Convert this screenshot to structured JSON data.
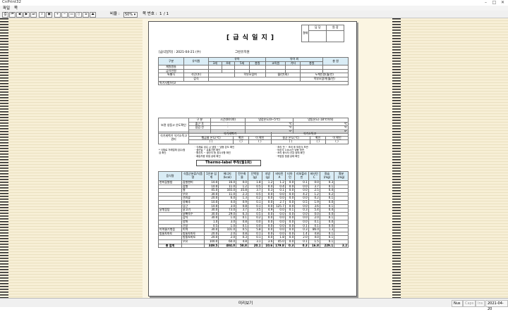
{
  "window": {
    "title": "CnPrint32"
  },
  "menu": {
    "items": [
      "파일",
      "쪽"
    ]
  },
  "toolbar": {
    "zoom_label": "비율 :",
    "zoom_value": "50%",
    "page_label": "쪽 번호 :",
    "page_value": "1",
    "page_total": "/ 1"
  },
  "doc": {
    "title": "[ 급 식 일 지 ]",
    "approval": {
      "side": "결재",
      "heads": [
        "담 당",
        "원 장"
      ]
    },
    "meal_date_label": "[급식일자] : 2021-04-21 (수)",
    "facility": "그린유치원",
    "attend": {
      "col_gubun": "구분",
      "col_teacher": "유치원",
      "col_child": "유아",
      "col_child_sub": "유아 외",
      "col_total": "총 원",
      "sub": [
        "3세",
        "4세",
        "5세",
        "총원",
        "교직원",
        "기타",
        "총원"
      ],
      "rows": [
        "재원원들",
        "급식인원"
      ]
    },
    "meal_rows": {
      "label": "특별식",
      "r1": "식단(조)",
      "r1b": "학부모참여",
      "r1c": "월/년(회)",
      "r1d": "누계인원(월/년)",
      "r2": "감식",
      "r2b": "학부모참여(월/년)"
    },
    "remarks": "특기사항/비고",
    "storage": {
      "title": "보관 냉동고 온도확인",
      "heads": [
        "구 분",
        "시간(00:00)",
        "냉장온도(0~5℃)",
        "냉동온도(-18℃이하)"
      ],
      "rows": [
        [
          "출근 후",
          ":",
          "℃",
          "℃"
        ],
        [
          "점검 전",
          ":",
          "℃",
          "℃"
        ],
        [
          "",
          ":",
          "℃",
          "℃"
        ]
      ]
    },
    "wash": {
      "title": "식기세척기 식기소독고 관리",
      "left_head": "식기세척기",
      "right_head": "식기소독고",
      "left": [
        "헹굼물 온도(℃)",
        "확인",
        "이 확인"
      ],
      "right": [
        "살균 온도(℃)",
        "확인",
        "이 확인"
      ],
      "blank": "(  )"
    },
    "notes_title": "* 식재료 거래업체 검수/점검 확인",
    "notes_left": [
      "· 식재료 검수 시 냉장 ~ 냉동 온도 확인",
      "· 생산일 ~ 유통기한 확인",
      "· 원산지 ~ 생산자 등 표시사항 확인",
      "· 배송차량 위생 상태 확인"
    ],
    "notes_right": [
      "· 조리 전 ~ 조리 후 보존식 보관",
      "· 보존식 144시간 냉동 보관",
      "· 조리 종사자 건강 상태 확인",
      "· 작업장 청결 상태 확인"
    ],
    "thermo": "Thermo-label 부착(월1회)",
    "table": {
      "heads": [
        "음식명",
        "식품군분류/식품명",
        "1인분 섭취",
        "에너지 (kcal)",
        "탄수화물",
        "단백질 (g)",
        "지방 (g)",
        "비타민A",
        "티아민",
        "리보플라빈",
        "비타민C",
        "칼슘 (mg)",
        "철분 (mg)"
      ],
      "meal_groups": [
        "현미찹쌀밥",
        "닭볶음탕",
        "미역줄기볶음",
        "방울토마토",
        "총 합계"
      ],
      "rows": [
        [
          "현미찹쌀밥",
          "찹쌀현미",
          "10.0",
          "16.0",
          "0.0",
          "1.8",
          "1.2",
          "1.2",
          "0.0",
          "0.1",
          "0.0",
          "0.3"
        ],
        [
          "",
          "찹쌀",
          "10.0",
          "11.0",
          "1.2",
          "0.5",
          "0.4",
          "0.4",
          "0.0",
          "0.0",
          "3.7",
          "0.1"
        ],
        [
          "",
          "쌀",
          "45.0",
          "165.0",
          "35.8",
          "3.7",
          "0.3",
          "0.1",
          "0.0",
          "0.0",
          "2.5",
          "0.4"
        ],
        [
          "",
          "우유",
          "30.0",
          "11.0",
          "2.3",
          "0.5",
          "0.0",
          "0.0",
          "0.0",
          "4.2",
          "1.2",
          "0.2"
        ],
        [
          "",
          "견과류",
          "20.0",
          "6.0",
          "1.3",
          "0.2",
          "0.0",
          "0.0",
          "0.0",
          "0.0",
          "0.2",
          "0.1"
        ],
        [
          "",
          "양배추",
          "10.0",
          "4.0",
          "0.9",
          "0.1",
          "0.0",
          "2.7",
          "0.0",
          "0.5",
          "1.9",
          "0.0"
        ],
        [
          "",
          "당근",
          "10.0",
          "3.0",
          "0.8",
          "0.1",
          "0.0",
          "125.7",
          "0.0",
          "0.0",
          "3.6",
          "0.1"
        ],
        [
          "닭볶음탕",
          "닭고기",
          "30.0",
          "73.0",
          "3.7",
          "3.5",
          "4.9",
          "0.0",
          "0.1",
          "0.3",
          "5.4",
          "0.4"
        ],
        [
          "",
          "닭뼈육수",
          "30.0",
          "29.0",
          "6.3",
          "0.5",
          "0.0",
          "0.0",
          "0.0",
          "0.0",
          "0.0",
          "0.0"
        ],
        [
          "",
          "감자",
          "30.0",
          "1.0",
          "0.1",
          "0.2",
          "0.0",
          "0.0",
          "0.0",
          "0.0",
          "2.0",
          "0.1"
        ],
        [
          "",
          "양파",
          "1.0",
          "3.0",
          "0.8",
          "0.0",
          "0.0",
          "0.0",
          "0.0",
          "0.0",
          "0.1",
          "0.0"
        ],
        [
          "",
          "간장",
          "0.5",
          "1.0",
          "0.1",
          "0.0",
          "0.0",
          "0.0",
          "0.0",
          "0.1",
          "0.1",
          "0.0"
        ],
        [
          "미역줄기볶음",
          "미역",
          "30.0",
          "101.0",
          "0.5",
          "5.8",
          "0.0",
          "0.0",
          "0.0",
          "0.3",
          "86.0",
          "1.3"
        ],
        [
          "방울토마토",
          "방울토마토",
          "20.0",
          "2.0",
          "0.8",
          "0.1",
          "0.0",
          "0.0",
          "0.0",
          "1.4",
          "4.8",
          "0.1"
        ],
        [
          "",
          "방울토마토",
          "20.0",
          "2.0",
          "0.3",
          "0.1",
          "0.0",
          "1.8",
          "0.0",
          "2.0",
          "4.0",
          "0.1"
        ],
        [
          "",
          "우유",
          "100.0",
          "60.0",
          "4.8",
          "3.1",
          "3.6",
          "45.0",
          "0.0",
          "0.1",
          "1.5",
          "0.1"
        ]
      ],
      "total": [
        "총 합계",
        "",
        "349.5",
        "484.0",
        "58.8",
        "20.1",
        "10.6",
        "179.8",
        "0.3",
        "0.3",
        "16.8",
        "229.1",
        "3.2"
      ]
    }
  },
  "status": {
    "center": "미리보기",
    "nus": "Nus",
    "caps": "Caps",
    "ins": "Ins",
    "date": "2021-04-20"
  }
}
